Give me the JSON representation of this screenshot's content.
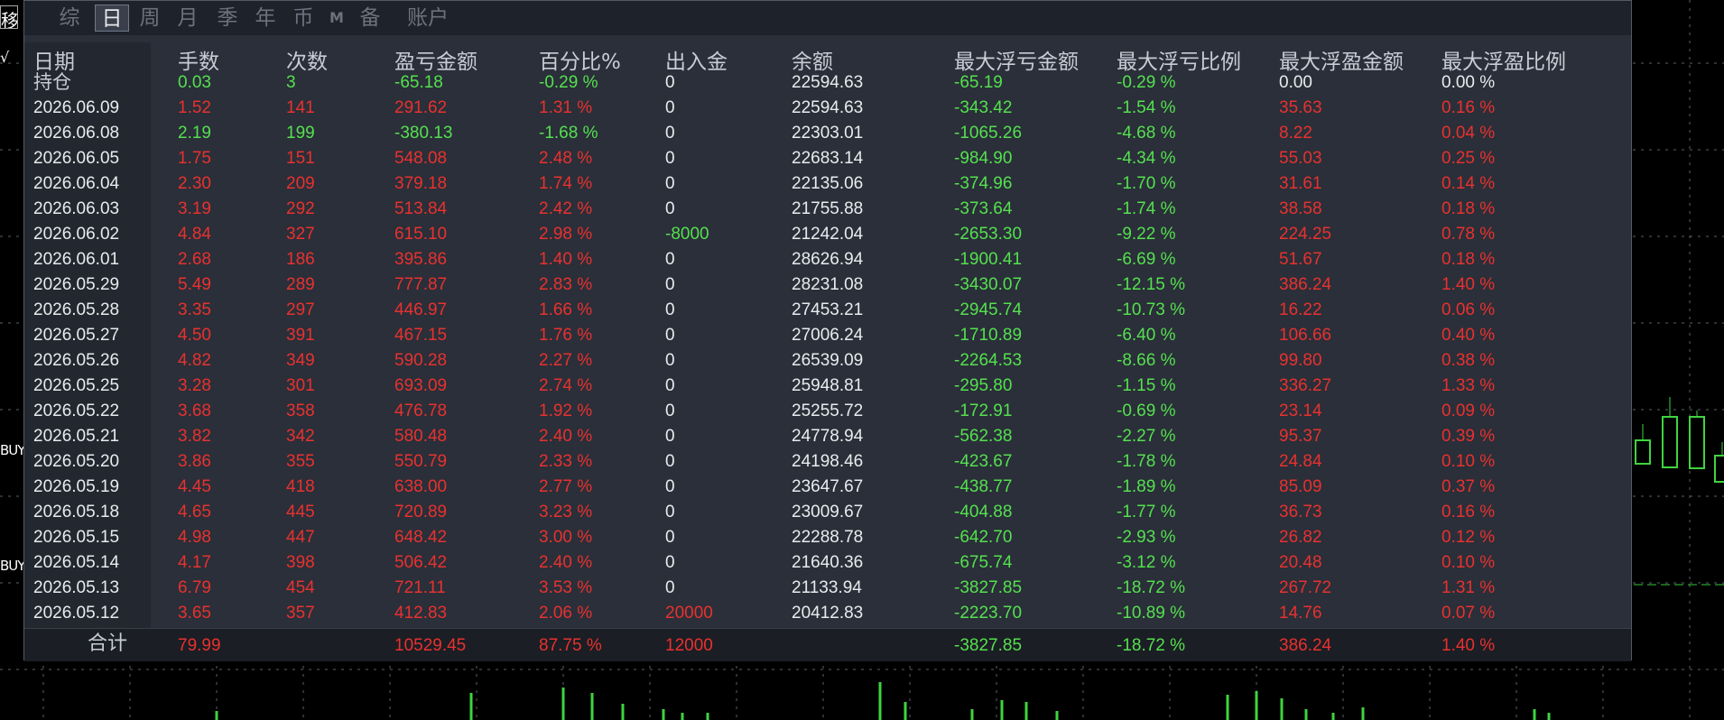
{
  "left_edge": {
    "top_char": "移",
    "check_char": "√",
    "buy_label_1": "BUY",
    "buy_label_2": "BUY"
  },
  "tabs": [
    {
      "label": "综",
      "active": false
    },
    {
      "label": "日",
      "active": true
    },
    {
      "label": "周",
      "active": false
    },
    {
      "label": "月",
      "active": false
    },
    {
      "label": "季",
      "active": false
    },
    {
      "label": "年",
      "active": false
    },
    {
      "label": "币",
      "active": false
    },
    {
      "label": "M",
      "active": false
    },
    {
      "label": "备",
      "active": false
    },
    {
      "label": "账户",
      "active": false
    }
  ],
  "headers": [
    "日期",
    "手数",
    "次数",
    "盈亏金额",
    "百分比%",
    "出入金",
    "余额",
    "最大浮亏金额",
    "最大浮亏比例",
    "最大浮盈金额",
    "最大浮盈比例"
  ],
  "rows": [
    {
      "date": "持仓",
      "lots": "0.03",
      "count": "3",
      "pnl": "-65.18",
      "pct": "-0.29 %",
      "inout": "0",
      "balance": "22594.63",
      "max_loss": "-65.19",
      "max_loss_pct": "-0.29 %",
      "max_gain": "0.00",
      "max_gain_pct": "0.00 %",
      "tone": "loss"
    },
    {
      "date": "2026.06.09",
      "lots": "1.52",
      "count": "141",
      "pnl": "291.62",
      "pct": "1.31 %",
      "inout": "0",
      "balance": "22594.63",
      "max_loss": "-343.42",
      "max_loss_pct": "-1.54 %",
      "max_gain": "35.63",
      "max_gain_pct": "0.16 %",
      "tone": "gain"
    },
    {
      "date": "2026.06.08",
      "lots": "2.19",
      "count": "199",
      "pnl": "-380.13",
      "pct": "-1.68 %",
      "inout": "0",
      "balance": "22303.01",
      "max_loss": "-1065.26",
      "max_loss_pct": "-4.68 %",
      "max_gain": "8.22",
      "max_gain_pct": "0.04 %",
      "tone": "loss"
    },
    {
      "date": "2026.06.05",
      "lots": "1.75",
      "count": "151",
      "pnl": "548.08",
      "pct": "2.48 %",
      "inout": "0",
      "balance": "22683.14",
      "max_loss": "-984.90",
      "max_loss_pct": "-4.34 %",
      "max_gain": "55.03",
      "max_gain_pct": "0.25 %",
      "tone": "gain"
    },
    {
      "date": "2026.06.04",
      "lots": "2.30",
      "count": "209",
      "pnl": "379.18",
      "pct": "1.74 %",
      "inout": "0",
      "balance": "22135.06",
      "max_loss": "-374.96",
      "max_loss_pct": "-1.70 %",
      "max_gain": "31.61",
      "max_gain_pct": "0.14 %",
      "tone": "gain"
    },
    {
      "date": "2026.06.03",
      "lots": "3.19",
      "count": "292",
      "pnl": "513.84",
      "pct": "2.42 %",
      "inout": "0",
      "balance": "21755.88",
      "max_loss": "-373.64",
      "max_loss_pct": "-1.74 %",
      "max_gain": "38.58",
      "max_gain_pct": "0.18 %",
      "tone": "gain"
    },
    {
      "date": "2026.06.02",
      "lots": "4.84",
      "count": "327",
      "pnl": "615.10",
      "pct": "2.98 %",
      "inout": "-8000",
      "balance": "21242.04",
      "max_loss": "-2653.30",
      "max_loss_pct": "-9.22 %",
      "max_gain": "224.25",
      "max_gain_pct": "0.78 %",
      "tone": "gain",
      "inout_tone": "green"
    },
    {
      "date": "2026.06.01",
      "lots": "2.68",
      "count": "186",
      "pnl": "395.86",
      "pct": "1.40 %",
      "inout": "0",
      "balance": "28626.94",
      "max_loss": "-1900.41",
      "max_loss_pct": "-6.69 %",
      "max_gain": "51.67",
      "max_gain_pct": "0.18 %",
      "tone": "gain"
    },
    {
      "date": "2026.05.29",
      "lots": "5.49",
      "count": "289",
      "pnl": "777.87",
      "pct": "2.83 %",
      "inout": "0",
      "balance": "28231.08",
      "max_loss": "-3430.07",
      "max_loss_pct": "-12.15 %",
      "max_gain": "386.24",
      "max_gain_pct": "1.40 %",
      "tone": "gain"
    },
    {
      "date": "2026.05.28",
      "lots": "3.35",
      "count": "297",
      "pnl": "446.97",
      "pct": "1.66 %",
      "inout": "0",
      "balance": "27453.21",
      "max_loss": "-2945.74",
      "max_loss_pct": "-10.73 %",
      "max_gain": "16.22",
      "max_gain_pct": "0.06 %",
      "tone": "gain"
    },
    {
      "date": "2026.05.27",
      "lots": "4.50",
      "count": "391",
      "pnl": "467.15",
      "pct": "1.76 %",
      "inout": "0",
      "balance": "27006.24",
      "max_loss": "-1710.89",
      "max_loss_pct": "-6.40 %",
      "max_gain": "106.66",
      "max_gain_pct": "0.40 %",
      "tone": "gain"
    },
    {
      "date": "2026.05.26",
      "lots": "4.82",
      "count": "349",
      "pnl": "590.28",
      "pct": "2.27 %",
      "inout": "0",
      "balance": "26539.09",
      "max_loss": "-2264.53",
      "max_loss_pct": "-8.66 %",
      "max_gain": "99.80",
      "max_gain_pct": "0.38 %",
      "tone": "gain"
    },
    {
      "date": "2026.05.25",
      "lots": "3.28",
      "count": "301",
      "pnl": "693.09",
      "pct": "2.74 %",
      "inout": "0",
      "balance": "25948.81",
      "max_loss": "-295.80",
      "max_loss_pct": "-1.15 %",
      "max_gain": "336.27",
      "max_gain_pct": "1.33 %",
      "tone": "gain"
    },
    {
      "date": "2026.05.22",
      "lots": "3.68",
      "count": "358",
      "pnl": "476.78",
      "pct": "1.92 %",
      "inout": "0",
      "balance": "25255.72",
      "max_loss": "-172.91",
      "max_loss_pct": "-0.69 %",
      "max_gain": "23.14",
      "max_gain_pct": "0.09 %",
      "tone": "gain"
    },
    {
      "date": "2026.05.21",
      "lots": "3.82",
      "count": "342",
      "pnl": "580.48",
      "pct": "2.40 %",
      "inout": "0",
      "balance": "24778.94",
      "max_loss": "-562.38",
      "max_loss_pct": "-2.27 %",
      "max_gain": "95.37",
      "max_gain_pct": "0.39 %",
      "tone": "gain"
    },
    {
      "date": "2026.05.20",
      "lots": "3.86",
      "count": "355",
      "pnl": "550.79",
      "pct": "2.33 %",
      "inout": "0",
      "balance": "24198.46",
      "max_loss": "-423.67",
      "max_loss_pct": "-1.78 %",
      "max_gain": "24.84",
      "max_gain_pct": "0.10 %",
      "tone": "gain"
    },
    {
      "date": "2026.05.19",
      "lots": "4.45",
      "count": "418",
      "pnl": "638.00",
      "pct": "2.77 %",
      "inout": "0",
      "balance": "23647.67",
      "max_loss": "-438.77",
      "max_loss_pct": "-1.89 %",
      "max_gain": "85.09",
      "max_gain_pct": "0.37 %",
      "tone": "gain"
    },
    {
      "date": "2026.05.18",
      "lots": "4.65",
      "count": "445",
      "pnl": "720.89",
      "pct": "3.23 %",
      "inout": "0",
      "balance": "23009.67",
      "max_loss": "-404.88",
      "max_loss_pct": "-1.77 %",
      "max_gain": "36.73",
      "max_gain_pct": "0.16 %",
      "tone": "gain"
    },
    {
      "date": "2026.05.15",
      "lots": "4.98",
      "count": "447",
      "pnl": "648.42",
      "pct": "3.00 %",
      "inout": "0",
      "balance": "22288.78",
      "max_loss": "-642.70",
      "max_loss_pct": "-2.93 %",
      "max_gain": "26.82",
      "max_gain_pct": "0.12 %",
      "tone": "gain"
    },
    {
      "date": "2026.05.14",
      "lots": "4.17",
      "count": "398",
      "pnl": "506.42",
      "pct": "2.40 %",
      "inout": "0",
      "balance": "21640.36",
      "max_loss": "-675.74",
      "max_loss_pct": "-3.12 %",
      "max_gain": "20.48",
      "max_gain_pct": "0.10 %",
      "tone": "gain"
    },
    {
      "date": "2026.05.13",
      "lots": "6.79",
      "count": "454",
      "pnl": "721.11",
      "pct": "3.53 %",
      "inout": "0",
      "balance": "21133.94",
      "max_loss": "-3827.85",
      "max_loss_pct": "-18.72 %",
      "max_gain": "267.72",
      "max_gain_pct": "1.31 %",
      "tone": "gain"
    },
    {
      "date": "2026.05.12",
      "lots": "3.65",
      "count": "357",
      "pnl": "412.83",
      "pct": "2.06 %",
      "inout": "20000",
      "balance": "20412.83",
      "max_loss": "-2223.70",
      "max_loss_pct": "-10.89 %",
      "max_gain": "14.76",
      "max_gain_pct": "0.07 %",
      "tone": "gain",
      "inout_tone": "red"
    }
  ],
  "total": {
    "label": "合计",
    "lots": "79.99",
    "count": "",
    "pnl": "10529.45",
    "pct": "87.75 %",
    "inout": "12000",
    "balance": "",
    "max_loss": "-3827.85",
    "max_loss_pct": "-18.72 %",
    "max_gain": "386.24",
    "max_gain_pct": "1.40 %"
  },
  "colors": {
    "gain": "#e8312f",
    "loss": "#55e04f",
    "neutral": "#e9ebee",
    "header": "#c7ccd5",
    "panel_bg": "#2a2f39",
    "tabbar_bg": "#1e222a"
  }
}
